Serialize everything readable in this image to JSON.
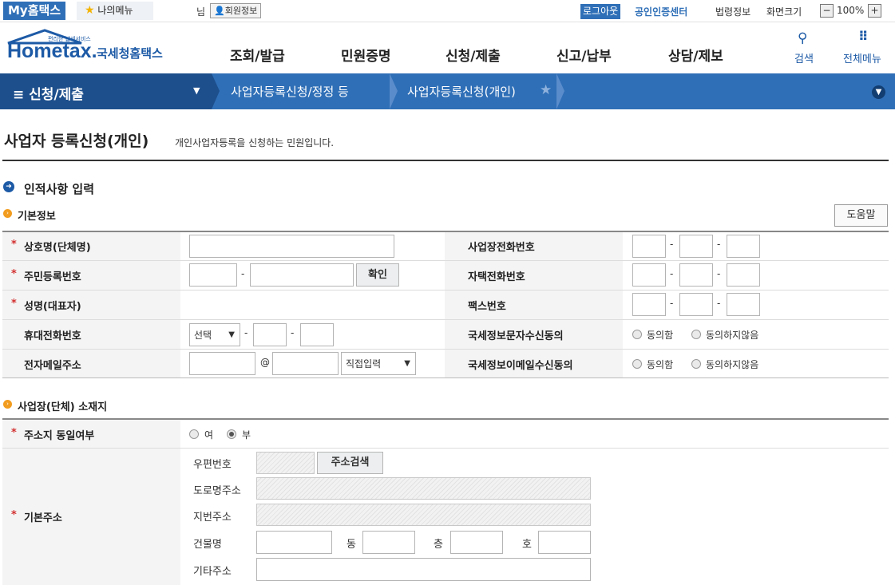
{
  "topbar": {
    "my_hometax": "My홈택스",
    "my_menu": "나의메뉴",
    "user_suffix": "님",
    "member_info": "회원정보",
    "logout": "로그아웃",
    "cert_center": "공인인증센터",
    "law_info": "법령정보",
    "zoom_label": "화면크기",
    "zoom_value": "100%",
    "zoom_minus": "−",
    "zoom_plus": "+"
  },
  "header": {
    "logo_sub": "편리한 납세서비스",
    "logo_home": "Hometax.",
    "logo_kr": "국세청홈택스",
    "nav": [
      "조회/발급",
      "민원증명",
      "신청/제출",
      "신고/납부",
      "상담/제보"
    ],
    "search": "검색",
    "all_menu": "전체메뉴"
  },
  "breadcrumb": {
    "main": "≡  신청/제출",
    "level2": "사업자등록신청/정정 등",
    "level3": "사업자등록신청(개인)"
  },
  "page": {
    "title": "사업자 등록신청(개인)",
    "desc": "개인사업자등록을 신청하는 민원입니다.",
    "section": "인적사항 입력",
    "help": "도움말"
  },
  "basic": {
    "heading": "기본정보",
    "req_mark": "*",
    "biz_name": "상호명(단체명)",
    "rrn": "주민등록번호",
    "confirm": "확인",
    "rep_name": "성명(대표자)",
    "mobile": "휴대전화번호",
    "mobile_select": "선택",
    "email": "전자메일주소",
    "email_at": "@",
    "email_domain": "직접입력",
    "biz_phone": "사업장전화번호",
    "home_phone": "자택전화번호",
    "fax": "팩스번호",
    "sms_consent": "국세정보문자수신동의",
    "email_consent": "국세정보이메일수신동의",
    "agree": "동의함",
    "disagree": "동의하지않음",
    "dash": "-"
  },
  "address": {
    "heading": "사업장(단체) 소재지",
    "same_addr": "주소지 동일여부",
    "yes": "여",
    "no": "부",
    "base_addr": "기본주소",
    "postcode": "우편번호",
    "search_btn": "주소검색",
    "road": "도로명주소",
    "lot": "지번주소",
    "building": "건물명",
    "dong": "동",
    "floor": "층",
    "ho": "호",
    "etc": "기타주소"
  },
  "colors": {
    "primary": "#2f6fb7",
    "dark": "#1d4f8c",
    "accent": "#f29c1f"
  }
}
